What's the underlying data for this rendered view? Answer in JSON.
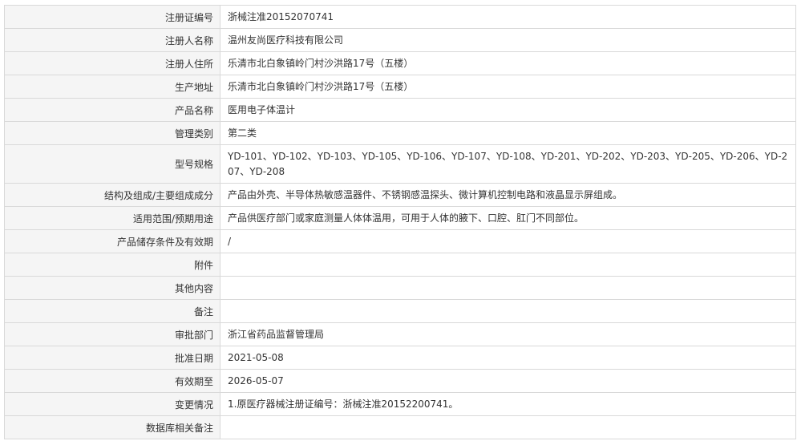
{
  "rows": [
    {
      "label": "注册证编号",
      "value": "浙械注准20152070741"
    },
    {
      "label": "注册人名称",
      "value": "温州友尚医疗科技有限公司"
    },
    {
      "label": "注册人住所",
      "value": "乐清市北白象镇岭门村沙洪路17号（五楼）"
    },
    {
      "label": "生产地址",
      "value": "乐清市北白象镇岭门村沙洪路17号（五楼）"
    },
    {
      "label": "产品名称",
      "value": "医用电子体温计"
    },
    {
      "label": "管理类别",
      "value": "第二类"
    },
    {
      "label": "型号规格",
      "value": "YD-101、YD-102、YD-103、YD-105、YD-106、YD-107、YD-108、YD-201、YD-202、YD-203、YD-205、YD-206、YD-207、YD-208"
    },
    {
      "label": "结构及组成/主要组成成分",
      "value": "产品由外壳、半导体热敏感温器件、不锈钢感温探头、微计算机控制电路和液晶显示屏组成。"
    },
    {
      "label": "适用范围/预期用途",
      "value": "产品供医疗部门或家庭测量人体体温用，可用于人体的腋下、口腔、肛门不同部位。"
    },
    {
      "label": "产品储存条件及有效期",
      "value": "/"
    },
    {
      "label": "附件",
      "value": ""
    },
    {
      "label": "其他内容",
      "value": ""
    },
    {
      "label": "备注",
      "value": ""
    },
    {
      "label": "审批部门",
      "value": "浙江省药品监督管理局"
    },
    {
      "label": "批准日期",
      "value": "2021-05-08"
    },
    {
      "label": "有效期至",
      "value": "2026-05-07"
    },
    {
      "label": "变更情况",
      "value": "1.原医疗器械注册证编号：浙械注准20152200741。"
    },
    {
      "label": "数据库相关备注",
      "value": ""
    }
  ]
}
